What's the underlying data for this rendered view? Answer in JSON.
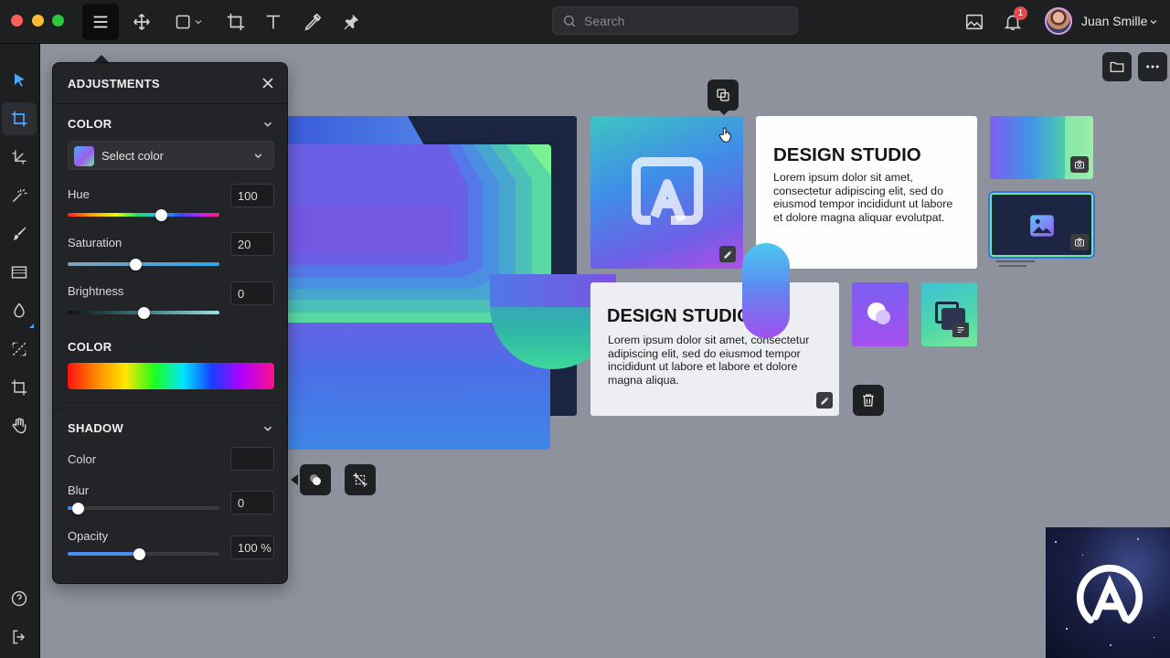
{
  "topbar": {
    "traffic_colors": [
      "#ff5f57",
      "#febc2e",
      "#28c840"
    ],
    "tools": [
      "menu-icon",
      "move-icon",
      "rectangle-icon",
      "crop-icon",
      "text-icon",
      "eyedropper-icon",
      "pin-icon"
    ],
    "search_placeholder": "Search",
    "notification_count": "1",
    "user_name": "Juan Smille"
  },
  "rail": {
    "tools": [
      "select-arrow-icon",
      "crop-icon",
      "transform-icon",
      "magic-wand-icon",
      "brush-icon",
      "rectangle-fill-icon",
      "drop-icon",
      "resize-icon",
      "crop-alt-icon",
      "hand-icon"
    ],
    "bottom": [
      "help-icon",
      "logout-icon"
    ]
  },
  "panel": {
    "title": "ADJUSTMENTS",
    "color_section": "COLOR",
    "select_color_label": "Select color",
    "hue": {
      "label": "Hue",
      "value": "100",
      "level": 0.62
    },
    "saturation": {
      "label": "Saturation",
      "value": "20",
      "level": 0.45
    },
    "brightness": {
      "label": "Brightness",
      "value": "0",
      "level": 0.5
    },
    "color_section_2": "COLOR",
    "shadow_section": "SHADOW",
    "shadow_color_label": "Color",
    "blur": {
      "label": "Blur",
      "value": "0",
      "level": 0.07
    },
    "opacity": {
      "label": "Opacity",
      "value": "100 %",
      "level": 0.47
    }
  },
  "canvas": {
    "card1": {
      "title": "DESIGN STUDIO",
      "text": "Lorem ipsum dolor sit amet, consectetur adipiscing elit, sed do eiusmod tempor incididunt ut labore et dolore magna aliquar evolutpat."
    },
    "card2": {
      "title": "DESIGN STUDIO",
      "text": "Lorem ipsum dolor sit amet, consectetur adipiscing elit, sed do eiusmod tempor incididunt ut labore et labore et dolore magna aliqua."
    }
  },
  "colors": {
    "accent": "#4aa8ff",
    "panel_bg": "#232427",
    "canvas_bg": "#8e929c"
  }
}
